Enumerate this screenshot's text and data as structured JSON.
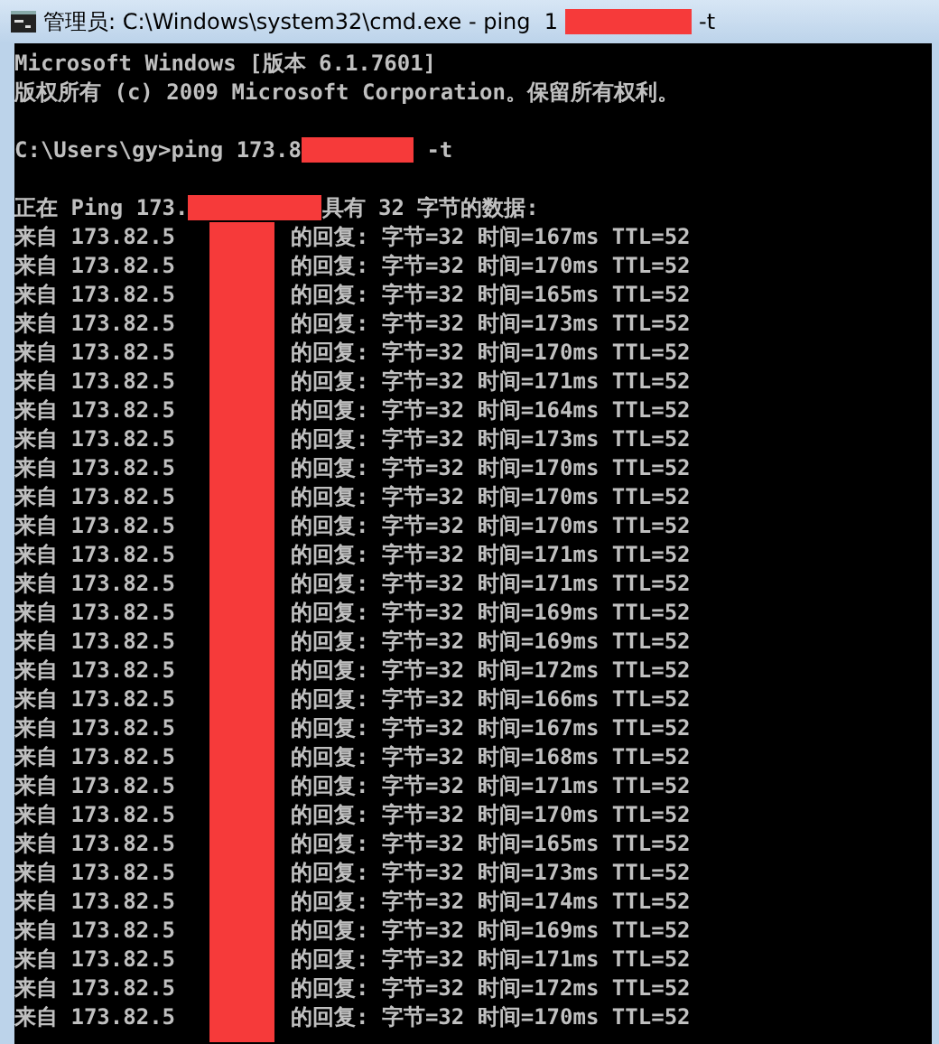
{
  "window": {
    "title_start": "管理员: C:\\Windows\\system32\\cmd.exe - ping  1",
    "title_end": "-t"
  },
  "console": {
    "banner": [
      "Microsoft Windows [版本 6.1.7601]",
      "版权所有 (c) 2009 Microsoft Corporation。保留所有权利。"
    ],
    "command": {
      "start": "C:\\Users\\gy>ping 173.8",
      "end": "-t"
    },
    "header": {
      "start": "正在 Ping 173.",
      "end": "具有 32 字节的数据:"
    },
    "replies": [
      {
        "source": "来自 173.82.5",
        "reply": "的回复: 字节=32 时间=167ms TTL=52"
      },
      {
        "source": "来自 173.82.5",
        "reply": "的回复: 字节=32 时间=170ms TTL=52"
      },
      {
        "source": "来自 173.82.5",
        "reply": "的回复: 字节=32 时间=165ms TTL=52"
      },
      {
        "source": "来自 173.82.5",
        "reply": "的回复: 字节=32 时间=173ms TTL=52"
      },
      {
        "source": "来自 173.82.5",
        "reply": "的回复: 字节=32 时间=170ms TTL=52"
      },
      {
        "source": "来自 173.82.5",
        "reply": "的回复: 字节=32 时间=171ms TTL=52"
      },
      {
        "source": "来自 173.82.5",
        "reply": "的回复: 字节=32 时间=164ms TTL=52"
      },
      {
        "source": "来自 173.82.5",
        "reply": "的回复: 字节=32 时间=173ms TTL=52"
      },
      {
        "source": "来自 173.82.5",
        "reply": "的回复: 字节=32 时间=170ms TTL=52"
      },
      {
        "source": "来自 173.82.5",
        "reply": "的回复: 字节=32 时间=170ms TTL=52"
      },
      {
        "source": "来自 173.82.5",
        "reply": "的回复: 字节=32 时间=170ms TTL=52"
      },
      {
        "source": "来自 173.82.5",
        "reply": "的回复: 字节=32 时间=171ms TTL=52"
      },
      {
        "source": "来自 173.82.5",
        "reply": "的回复: 字节=32 时间=171ms TTL=52"
      },
      {
        "source": "来自 173.82.5",
        "reply": "的回复: 字节=32 时间=169ms TTL=52"
      },
      {
        "source": "来自 173.82.5",
        "reply": "的回复: 字节=32 时间=169ms TTL=52"
      },
      {
        "source": "来自 173.82.5",
        "reply": "的回复: 字节=32 时间=172ms TTL=52"
      },
      {
        "source": "来自 173.82.5",
        "reply": "的回复: 字节=32 时间=166ms TTL=52"
      },
      {
        "source": "来自 173.82.5",
        "reply": "的回复: 字节=32 时间=167ms TTL=52"
      },
      {
        "source": "来自 173.82.5",
        "reply": "的回复: 字节=32 时间=168ms TTL=52"
      },
      {
        "source": "来自 173.82.5",
        "reply": "的回复: 字节=32 时间=171ms TTL=52"
      },
      {
        "source": "来自 173.82.5",
        "reply": "的回复: 字节=32 时间=170ms TTL=52"
      },
      {
        "source": "来自 173.82.5",
        "reply": "的回复: 字节=32 时间=165ms TTL=52"
      },
      {
        "source": "来自 173.82.5",
        "reply": "的回复: 字节=32 时间=173ms TTL=52"
      },
      {
        "source": "来自 173.82.5",
        "reply": "的回复: 字节=32 时间=174ms TTL=52"
      },
      {
        "source": "来自 173.82.5",
        "reply": "的回复: 字节=32 时间=169ms TTL=52"
      },
      {
        "source": "来自 173.82.5",
        "reply": "的回复: 字节=32 时间=171ms TTL=52"
      },
      {
        "source": "来自 173.82.5",
        "reply": "的回复: 字节=32 时间=172ms TTL=52"
      },
      {
        "source": "来自 173.82.5",
        "reply": "的回复: 字节=32 时间=170ms TTL=52"
      }
    ]
  }
}
